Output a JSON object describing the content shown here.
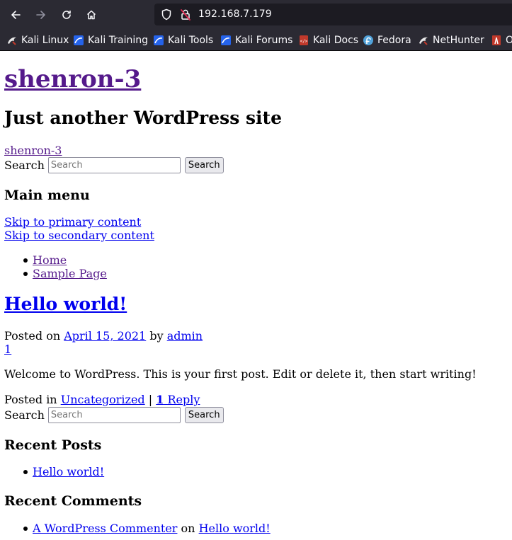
{
  "browser": {
    "url": "192.168.7.179",
    "bookmarks": [
      {
        "label": "Kali Linux",
        "icon": "kali-dragon-icon",
        "color": "#e0e0e0"
      },
      {
        "label": "Kali Training",
        "icon": "kali-training-icon",
        "color": "#3b82f6"
      },
      {
        "label": "Kali Tools",
        "icon": "kali-tools-icon",
        "color": "#3b82f6"
      },
      {
        "label": "Kali Forums",
        "icon": "kali-forums-icon",
        "color": "#3b82f6"
      },
      {
        "label": "Kali Docs",
        "icon": "kali-docs-icon",
        "color": "#c0392b"
      },
      {
        "label": "Fedora",
        "icon": "fedora-icon",
        "color": "#51a2da"
      },
      {
        "label": "NetHunter",
        "icon": "nethunter-icon",
        "color": "#c0392b"
      },
      {
        "label": "O",
        "icon": "offsec-icon",
        "color": "#c0392b"
      }
    ]
  },
  "site": {
    "title": "shenron-3",
    "description": "Just another WordPress site",
    "breadcrumb": "shenron-3"
  },
  "search": {
    "label": "Search",
    "placeholder": "Search",
    "button": "Search"
  },
  "menu": {
    "heading": "Main menu",
    "skip_primary": "Skip to primary content",
    "skip_secondary": "Skip to secondary content",
    "items": [
      "Home",
      "Sample Page"
    ]
  },
  "post": {
    "title": "Hello world!",
    "posted_on_prefix": "Posted on",
    "date": "April 15, 2021",
    "by": "by",
    "author": "admin",
    "comment_count": "1",
    "body": "Welcome to WordPress. This is your first post. Edit or delete it, then start writing!",
    "posted_in_prefix": "Posted in",
    "category": "Uncategorized",
    "separator": "|",
    "reply_count": "1",
    "reply_label": "Reply"
  },
  "widgets": {
    "recent_posts_heading": "Recent Posts",
    "recent_posts": [
      "Hello world!"
    ],
    "recent_comments_heading": "Recent Comments",
    "recent_comment": {
      "author": "A WordPress Commenter",
      "on": "on",
      "post": "Hello world!"
    }
  }
}
